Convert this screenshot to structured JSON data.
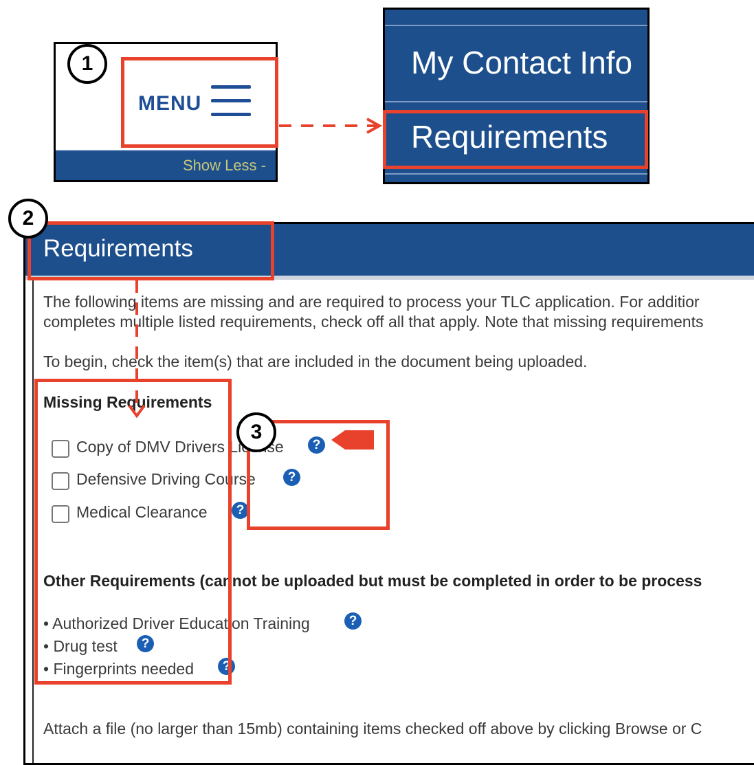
{
  "step_badges": {
    "one": "1",
    "two": "2",
    "three": "3"
  },
  "panel1": {
    "menu_label": "MENU",
    "show_less": "Show Less -"
  },
  "panel2": {
    "items": [
      "My Contact Info",
      "Requirements"
    ]
  },
  "main": {
    "title": "Requirements",
    "intro_line1": "The following items are missing and are required to process your TLC application. For additior",
    "intro_line2": "completes multiple listed requirements, check off all that apply. Note that missing requirements",
    "instruction": "To begin, check the item(s) that are included in the document being uploaded.",
    "missing_heading": "Missing Requirements",
    "missing_items": [
      "Copy of DMV Drivers License",
      "Defensive Driving Course",
      "Medical Clearance"
    ],
    "other_heading": "Other Requirements (cannot be uploaded but must be completed in order to be process",
    "other_items": [
      "• Authorized Driver Education Training",
      "• Drug test",
      "• Fingerprints needed"
    ],
    "attach_text": "Attach a file (no larger than 15mb) containing items checked off above by clicking Browse or C",
    "help_glyph": "?"
  },
  "colors": {
    "accent_red": "#e8412c",
    "nav_blue": "#1c4f8c",
    "help_blue": "#1a5fb4"
  },
  "icons": [
    "hamburger-icon",
    "help-icon",
    "arrow-icon"
  ]
}
